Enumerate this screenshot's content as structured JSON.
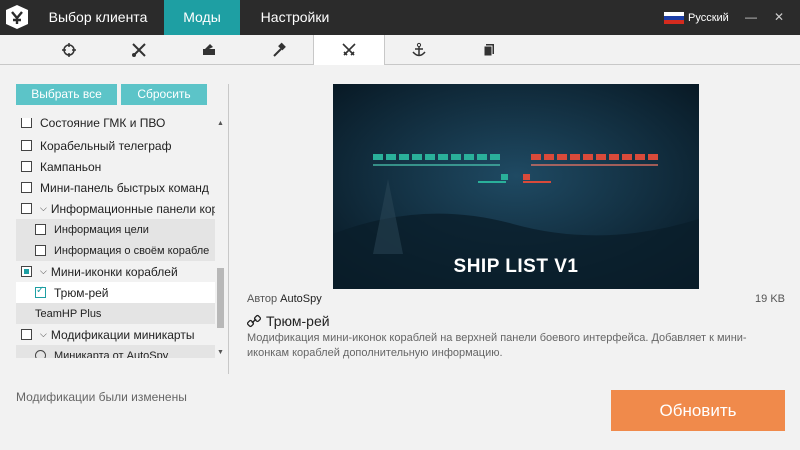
{
  "topbar": {
    "tabs": [
      "Выбор клиента",
      "Моды",
      "Настройки"
    ],
    "active_tab": "Моды",
    "language": "Русский"
  },
  "categories": [
    "crosshair-icon",
    "tools-icon",
    "battle-icon",
    "hammer-icon",
    "crossed-swords-icon",
    "anchor-icon",
    "pages-icon"
  ],
  "active_category": "crossed-swords-icon",
  "buttons": {
    "select_all": "Выбрать все",
    "reset": "Сбросить",
    "update": "Обновить"
  },
  "mod_list": {
    "items": [
      {
        "label": "Состояние ГМК и ПВО",
        "type": "checkbox",
        "state": "unchecked"
      },
      {
        "label": "Корабельный телеграф",
        "type": "checkbox",
        "state": "unchecked"
      },
      {
        "label": "Кампаньон",
        "type": "checkbox",
        "state": "unchecked"
      },
      {
        "label": "Мини-панель быстрых команд",
        "type": "checkbox",
        "state": "unchecked"
      },
      {
        "label": "Информационные панели кор",
        "type": "group",
        "state": "unchecked"
      },
      {
        "label": "Информация цели",
        "type": "checkbox",
        "state": "unchecked"
      },
      {
        "label": "Информация о своём корабле",
        "type": "checkbox",
        "state": "unchecked"
      },
      {
        "label": "Мини-иконки кораблей",
        "type": "group",
        "state": "partial"
      },
      {
        "label": "Трюм-рей",
        "type": "checkbox",
        "state": "checked"
      },
      {
        "label": "TeamHP Plus",
        "type": "none",
        "state": "none"
      },
      {
        "label": "Модификации миникарты",
        "type": "group",
        "state": "unchecked"
      },
      {
        "label": "Миникарта от AutoSpy",
        "type": "radio",
        "state": "unchecked"
      }
    ]
  },
  "status_text": "Модификации были изменены",
  "details": {
    "preview_title": "SHIP LIST V1",
    "author_label": "Автор",
    "author": "AutoSpy",
    "size": "19 KB",
    "title": "Трюм-рей",
    "description": "Модификация мини-иконок кораблей на верхней панели боевого интерфейса. Добавляет к мини-иконкам кораблей дополнительную информацию."
  },
  "colors": {
    "accent": "#1e9fa3",
    "button": "#5cc4c8",
    "update": "#f08a4b",
    "topbar": "#2b2b2b"
  }
}
